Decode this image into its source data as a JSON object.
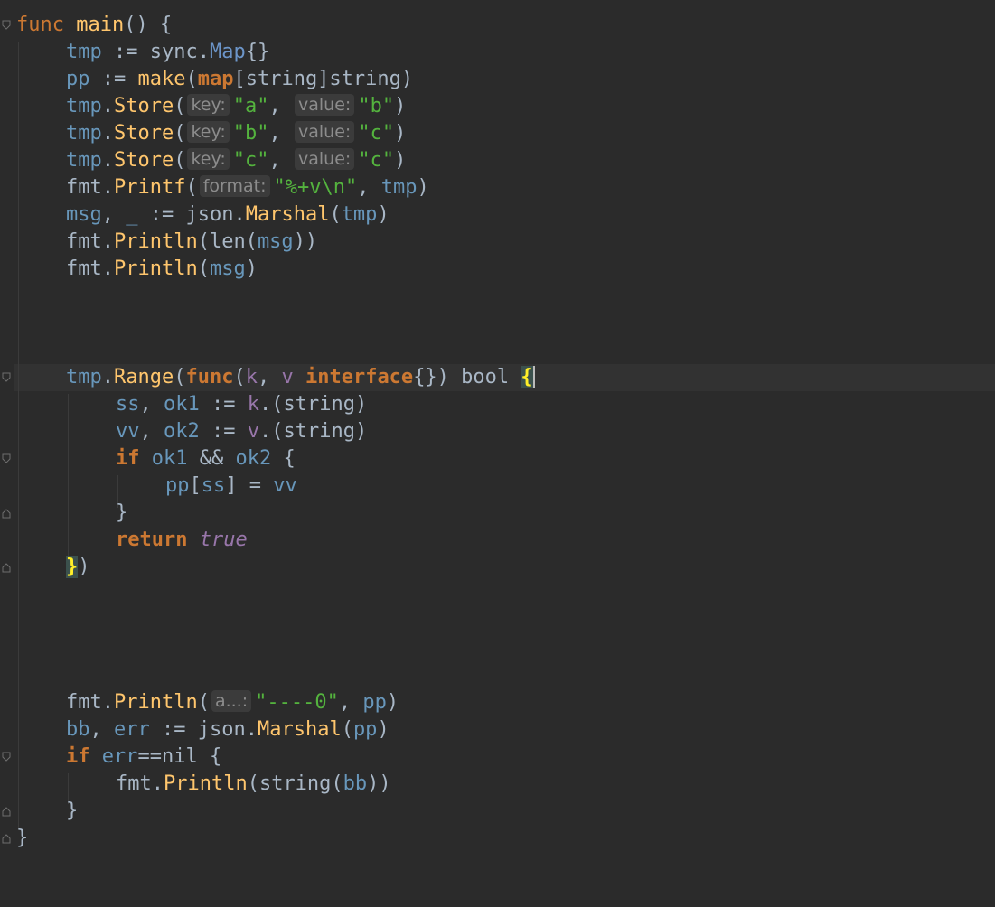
{
  "editor": {
    "language": "go",
    "colors": {
      "background": "#2b2b2b",
      "keyword": "#cc7832",
      "function": "#ffc66d",
      "string": "#6a8759",
      "identifier": "#6897bb",
      "hint": "#8c8c8c"
    },
    "lines": {
      "l1": {
        "kw": "func",
        "name": "main",
        "rest": "() {"
      },
      "l2": {
        "v": "tmp",
        "op": " := sync.",
        "t": "Map",
        "rest": "{}"
      },
      "l3": {
        "v": "pp",
        "op": " := ",
        "fn": "make",
        "p": "(",
        "kw": "map",
        "rest": "[string]string)"
      },
      "l4": {
        "v": "tmp",
        "dot": ".",
        "fn": "Store",
        "p": "(",
        "h1": "key:",
        "s1": "\"a\"",
        "c": ", ",
        "h2": "value:",
        "s2": "\"b\"",
        "e": ")"
      },
      "l5": {
        "v": "tmp",
        "dot": ".",
        "fn": "Store",
        "p": "(",
        "h1": "key:",
        "s1": "\"b\"",
        "c": ", ",
        "h2": "value:",
        "s2": "\"c\"",
        "e": ")"
      },
      "l6": {
        "v": "tmp",
        "dot": ".",
        "fn": "Store",
        "p": "(",
        "h1": "key:",
        "s1": "\"c\"",
        "c": ", ",
        "h2": "value:",
        "s2": "\"c\"",
        "e": ")"
      },
      "l7": {
        "pkg": "fmt.",
        "fn": "Printf",
        "p": "(",
        "h1": "format:",
        "s1": "\"%+v\\n\"",
        "c": ", ",
        "v": "tmp",
        "e": ")"
      },
      "l8": {
        "v1": "msg",
        "c": ", ",
        "u": "_",
        "op": " := json.",
        "fn": "Marshal",
        "p": "(",
        "v2": "tmp",
        "e": ")"
      },
      "l9": {
        "pkg": "fmt.",
        "fn": "Println",
        "p": "(len(",
        "v": "msg",
        "e": "))"
      },
      "l10": {
        "pkg": "fmt.",
        "fn": "Println",
        "p": "(",
        "v": "msg",
        "e": ")"
      },
      "l11": {
        "v": "tmp",
        "dot": ".",
        "fn": "Range",
        "p": "(",
        "kw": "func",
        "p2": "(",
        "a": "k",
        "c": ", ",
        "b": "v",
        "sp": " ",
        "kw2": "interface",
        "rest": "{}) bool ",
        "brace": "{"
      },
      "l12": {
        "v1": "ss",
        "c": ", ",
        "v2": "ok1",
        "op": " := ",
        "k": "k",
        "rest": ".(string)"
      },
      "l13": {
        "v1": "vv",
        "c": ", ",
        "v2": "ok2",
        "op": " := ",
        "k": "v",
        "rest": ".(string)"
      },
      "l14": {
        "kw": "if",
        "sp": " ",
        "v1": "ok1",
        "op": " && ",
        "v2": "ok2",
        "rest": " {"
      },
      "l15": {
        "v1": "pp",
        "b1": "[",
        "v2": "ss",
        "op": "] = ",
        "v3": "vv"
      },
      "l16": {
        "rest": "}"
      },
      "l17": {
        "kw": "return",
        "sp": " ",
        "lit": "true"
      },
      "l18": {
        "brace": "}",
        "rest": ")"
      },
      "l19": {
        "pkg": "fmt.",
        "fn": "Println",
        "p": "(",
        "h1": "a...:",
        "s1": "\"----0\"",
        "c": ", ",
        "v": "pp",
        "e": ")"
      },
      "l20": {
        "v1": "bb",
        "c": ", ",
        "v2": "err",
        "op": " := json.",
        "fn": "Marshal",
        "p": "(",
        "v3": "pp",
        "e": ")"
      },
      "l21": {
        "kw": "if",
        "sp": " ",
        "v": "err",
        "rest": "==nil {"
      },
      "l22": {
        "pkg": "fmt.",
        "fn": "Println",
        "p": "(string(",
        "v": "bb",
        "e": "))"
      },
      "l23": {
        "rest": "}"
      },
      "l24": {
        "rest": "}"
      }
    }
  }
}
